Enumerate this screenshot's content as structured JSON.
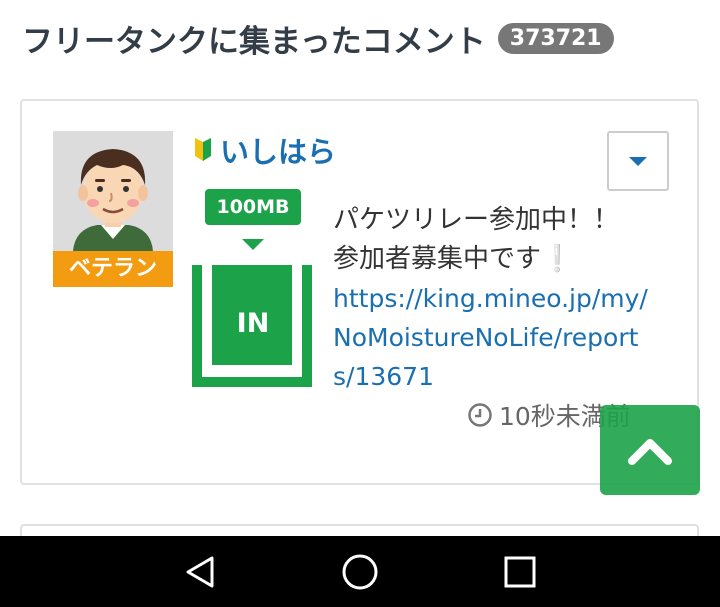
{
  "header": {
    "title": "フリータンクに集まったコメント",
    "count": "373721"
  },
  "comment": {
    "user": {
      "name": "いしはら",
      "rank": "ベテラン",
      "avatar_icon": "person-avatar",
      "beginner_icon": "beginner-mark-icon"
    },
    "tank": {
      "amount": "100MB",
      "direction": "IN"
    },
    "text_lines": [
      "パケツリレー参加中！！",
      "参加者募集中です"
    ],
    "exclamation": "❕",
    "link": "https://king.mineo.jp/my/NoMoistureNoLife/reports/13671",
    "time": "10秒未満前"
  },
  "colors": {
    "accent_green": "#1ca34a",
    "link_blue": "#1a6fb0",
    "rank_orange": "#f39c12",
    "badge_gray": "#777777"
  },
  "navbar": {
    "icons": [
      "back-icon",
      "home-icon",
      "recents-icon"
    ]
  }
}
